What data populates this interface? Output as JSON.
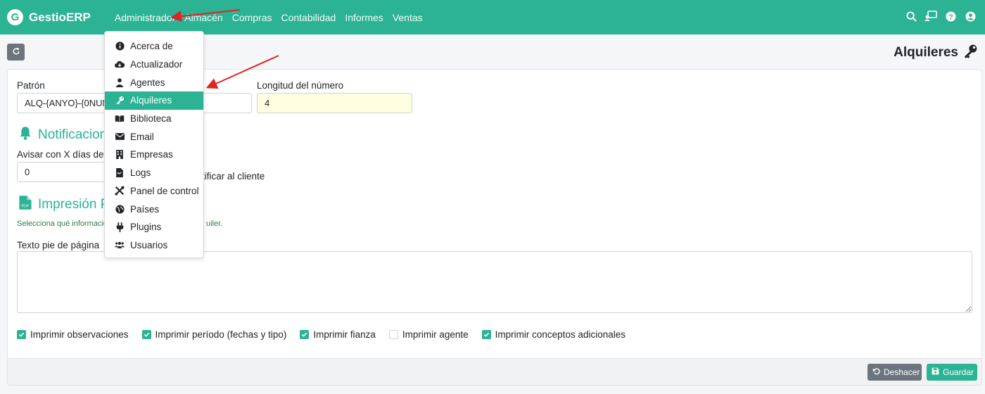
{
  "brand": {
    "logo_letter": "G",
    "name": "GestioERP"
  },
  "nav": {
    "items": [
      {
        "label": "Administrador"
      },
      {
        "label": "Almacén"
      },
      {
        "label": "Compras"
      },
      {
        "label": "Contabilidad"
      },
      {
        "label": "Informes"
      },
      {
        "label": "Ventas"
      }
    ],
    "icons": [
      "search-icon",
      "user-screen-icon",
      "help-icon",
      "user-icon"
    ]
  },
  "page": {
    "title": "Alquileres",
    "title_icon": "key-icon",
    "reload_icon": "reload-icon"
  },
  "form": {
    "pattern": {
      "label": "Patrón",
      "value": "ALQ-{ANYO}-{0NUM"
    },
    "number_length": {
      "label": "Longitud del número",
      "value": "4"
    },
    "notifications": {
      "title": "Notificacion",
      "icon": "bell-icon"
    },
    "warn_days": {
      "label": "Avisar con X días de an",
      "value": "0"
    },
    "notify_client": {
      "label": "tificar al cliente"
    },
    "print": {
      "title": "Impresión P",
      "icon": "pdf-icon",
      "help": "Selecciona qué informacio",
      "help_tail": "uiler."
    },
    "footer_text": {
      "label": "Texto pie de página",
      "value": ""
    },
    "checkboxes": [
      {
        "label": "Imprimir observaciones",
        "checked": true
      },
      {
        "label": "Imprimir período (fechas y tipo)",
        "checked": true
      },
      {
        "label": "Imprimir fianza",
        "checked": true
      },
      {
        "label": "Imprimir agente",
        "checked": false
      },
      {
        "label": "Imprimir conceptos adicionales",
        "checked": true
      }
    ]
  },
  "footer_buttons": {
    "undo": "Deshacer",
    "save": "Guardar"
  },
  "dropdown": {
    "items": [
      {
        "label": "Acerca de",
        "icon": "info-icon"
      },
      {
        "label": "Actualizador",
        "icon": "cloud-download-icon"
      },
      {
        "label": "Agentes",
        "icon": "user-tie-icon"
      },
      {
        "label": "Alquileres",
        "icon": "key-icon",
        "active": true
      },
      {
        "label": "Biblioteca",
        "icon": "book-icon"
      },
      {
        "label": "Email",
        "icon": "envelope-icon"
      },
      {
        "label": "Empresas",
        "icon": "building-icon"
      },
      {
        "label": "Logs",
        "icon": "file-icon"
      },
      {
        "label": "Panel de control",
        "icon": "tools-icon"
      },
      {
        "label": "Países",
        "icon": "globe-icon"
      },
      {
        "label": "Plugins",
        "icon": "plug-icon"
      },
      {
        "label": "Usuarios",
        "icon": "users-icon"
      }
    ]
  },
  "colors": {
    "accent": "#2bb394",
    "annotation_arrow": "#e02424",
    "secondary": "#6c757d"
  }
}
